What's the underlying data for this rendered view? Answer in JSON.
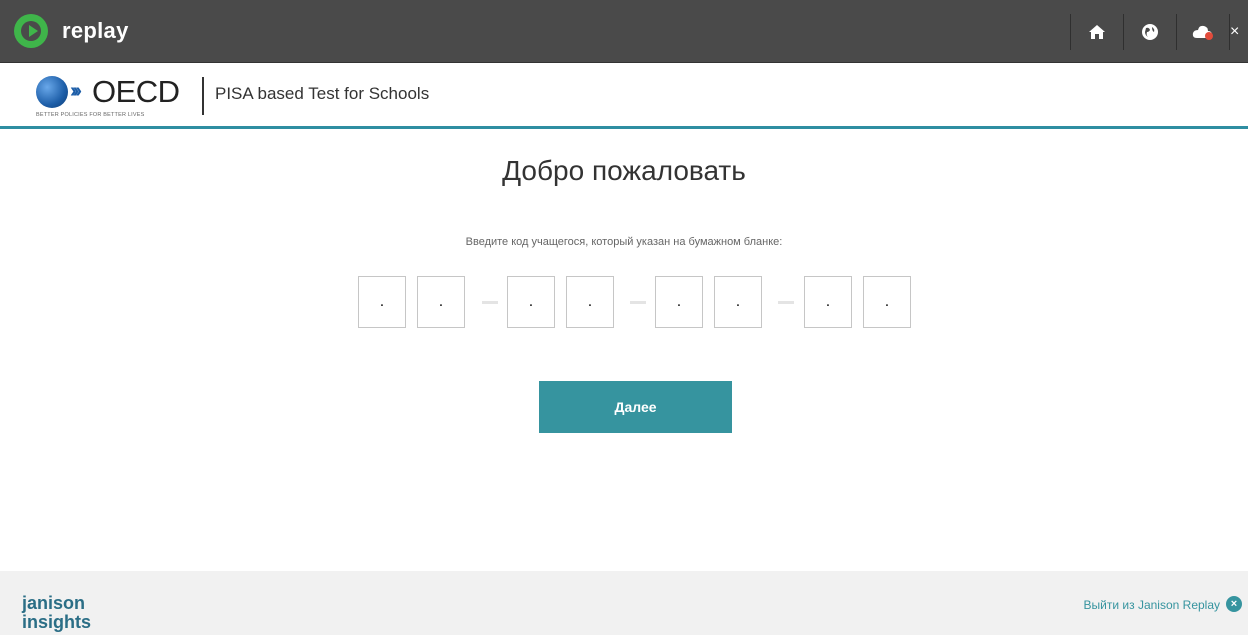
{
  "app": {
    "brand": "replay"
  },
  "topbar": {
    "home_icon": "home-icon",
    "globe_icon": "globe-icon",
    "cloud_icon": "cloud-icon",
    "more_glyph": "×"
  },
  "header": {
    "org_logo_text": "OECD",
    "org_tagline": "BETTER POLICIES FOR BETTER LIVES",
    "site_title": "PISA based Test for Schools"
  },
  "main": {
    "welcome_title": "Добро пожаловать",
    "instruction": "Введите код учащегося, который указан на бумажном бланке:",
    "code_fields": [
      ".",
      ".",
      ".",
      ".",
      ".",
      ".",
      ".",
      "."
    ],
    "next_button": "Далее"
  },
  "footer": {
    "brand_line1": "janison",
    "brand_line2": "insights",
    "exit_link": "Выйти из Janison Replay"
  },
  "colors": {
    "topbar": "#4a4a4a",
    "accent": "#36949f",
    "replay_green": "#3fb54a",
    "footer_bg": "#f1f1f1"
  }
}
